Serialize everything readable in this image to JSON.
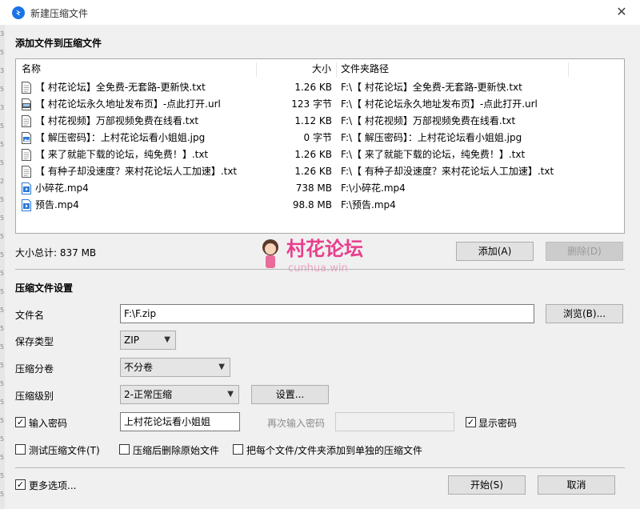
{
  "window": {
    "title": "新建压缩文件",
    "close_glyph": "✕"
  },
  "left_strip_digits": "3\n5\n3\n5\n3\n5\n5\n5\n2\n5\n5\n5\n5\n5\n5\n5\n5\n5\n5\n5\n5\n5\n5\n5\n5\n5",
  "add_section": {
    "title": "添加文件到压缩文件"
  },
  "columns": {
    "name": "名称",
    "size": "大小",
    "path": "文件夹路径"
  },
  "files": [
    {
      "icon": "text-file-icon",
      "name": "【 村花论坛】全免费-无套路-更新快.txt",
      "size": "1.26 KB",
      "path": "F:\\【 村花论坛】全免费-无套路-更新快.txt"
    },
    {
      "icon": "url-file-icon",
      "name": "【 村花论坛永久地址发布页】-点此打开.url",
      "size": "123 字节",
      "path": "F:\\【 村花论坛永久地址发布页】-点此打开.url"
    },
    {
      "icon": "text-file-icon",
      "name": "【 村花视频】万部视频免费在线看.txt",
      "size": "1.12 KB",
      "path": "F:\\【 村花视频】万部视频免费在线看.txt"
    },
    {
      "icon": "image-file-icon",
      "name": "【 解压密码】：上村花论坛看小姐姐.jpg",
      "size": "0 字节",
      "path": "F:\\【 解压密码】：上村花论坛看小姐姐.jpg"
    },
    {
      "icon": "text-file-icon",
      "name": "【 来了就能下载的论坛，纯免费！】.txt",
      "size": "1.26 KB",
      "path": "F:\\【 来了就能下载的论坛，纯免费！】.txt"
    },
    {
      "icon": "text-file-icon",
      "name": "【 有种子却没速度？来村花论坛人工加速】.txt",
      "size": "1.26 KB",
      "path": "F:\\【 有种子却没速度？来村花论坛人工加速】.txt"
    },
    {
      "icon": "video-file-icon",
      "name": "小碎花.mp4",
      "size": "738 MB",
      "path": "F:\\小碎花.mp4"
    },
    {
      "icon": "video-file-icon",
      "name": "预告.mp4",
      "size": "98.8 MB",
      "path": "F:\\预告.mp4"
    }
  ],
  "total": "大小总计: 837 MB",
  "watermark": {
    "title": "村花论坛",
    "subtitle": "cunhua.win"
  },
  "buttons": {
    "add": "添加(A)",
    "delete": "删除(D)",
    "browse": "浏览(B)...",
    "settings": "设置...",
    "start": "开始(S)",
    "cancel": "取消"
  },
  "settings_section": {
    "title": "压缩文件设置"
  },
  "fields": {
    "filename_label": "文件名",
    "filename_value": "F:\\F.zip",
    "save_type_label": "保存类型",
    "save_type_value": "ZIP",
    "split_label": "压缩分卷",
    "split_value": "不分卷",
    "level_label": "压缩级别",
    "level_value": "2-正常压缩",
    "password_label": "输入密码",
    "password_value": "上村花论坛看小姐姐",
    "repeat_password_label": "再次输入密码",
    "show_password_label": "显示密码"
  },
  "options": {
    "test_archive": "测试压缩文件(T)",
    "delete_after": "压缩后删除原始文件",
    "separate_archives": "把每个文件/文件夹添加到单独的压缩文件",
    "more_options": "更多选项..."
  },
  "checks": {
    "password": "✓",
    "show_password": "✓",
    "more_options": "✓"
  },
  "colors": {
    "accent": "#1a73e8",
    "watermark_pink": "#e83e8c",
    "list_border": "#a9a9a9",
    "dialog_bg": "#f0f0f0"
  }
}
